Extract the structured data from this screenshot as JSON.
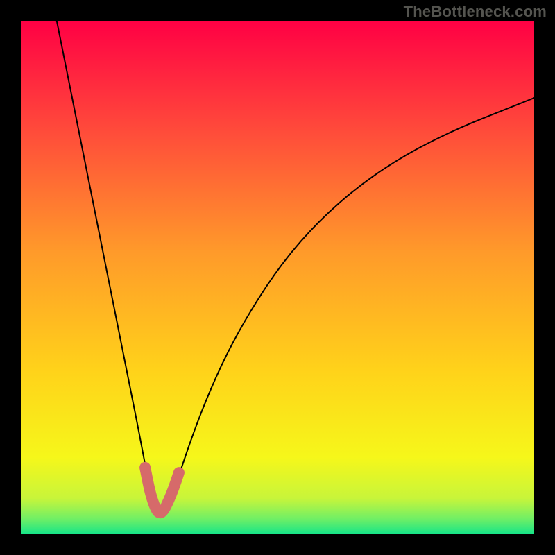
{
  "watermark": "TheBottleneck.com",
  "colors": {
    "frame_bg": "#000000",
    "curve_stroke": "#000000",
    "highlight_stroke": "#d66a6a",
    "gradient_stops": [
      {
        "offset": "0%",
        "color": "#ff0044"
      },
      {
        "offset": "22%",
        "color": "#ff4d3a"
      },
      {
        "offset": "45%",
        "color": "#ff9a2a"
      },
      {
        "offset": "68%",
        "color": "#ffd21a"
      },
      {
        "offset": "85%",
        "color": "#f6f71a"
      },
      {
        "offset": "93%",
        "color": "#c8f53a"
      },
      {
        "offset": "97%",
        "color": "#70ef65"
      },
      {
        "offset": "100%",
        "color": "#16e589"
      }
    ]
  },
  "chart_data": {
    "type": "line",
    "title": "",
    "xlabel": "",
    "ylabel": "",
    "x_range": [
      0,
      100
    ],
    "y_range": [
      0,
      100
    ],
    "notes": "V-shaped bottleneck curve. y=100 at top (red), y=0 at bottom (green). Minimum sits near x≈27, y≈4. Short pink segment overlays the very bottom of the V.",
    "curve_xy": [
      [
        7,
        100
      ],
      [
        9,
        90
      ],
      [
        11,
        80
      ],
      [
        13,
        70
      ],
      [
        15,
        60
      ],
      [
        17,
        50
      ],
      [
        19,
        40
      ],
      [
        21,
        30
      ],
      [
        23,
        20
      ],
      [
        24.5,
        12
      ],
      [
        26,
        6
      ],
      [
        27,
        4
      ],
      [
        28,
        5
      ],
      [
        29.5,
        8
      ],
      [
        31,
        12
      ],
      [
        33,
        18
      ],
      [
        36,
        26
      ],
      [
        40,
        35
      ],
      [
        45,
        44
      ],
      [
        51,
        53
      ],
      [
        58,
        61
      ],
      [
        66,
        68
      ],
      [
        75,
        74
      ],
      [
        85,
        79
      ],
      [
        95,
        83
      ],
      [
        100,
        85
      ]
    ],
    "highlight_xy": [
      [
        24.2,
        13
      ],
      [
        25.2,
        8
      ],
      [
        26.2,
        5
      ],
      [
        27.0,
        4
      ],
      [
        27.8,
        4.5
      ],
      [
        28.8,
        6.5
      ],
      [
        29.8,
        9
      ],
      [
        30.8,
        12
      ]
    ]
  }
}
